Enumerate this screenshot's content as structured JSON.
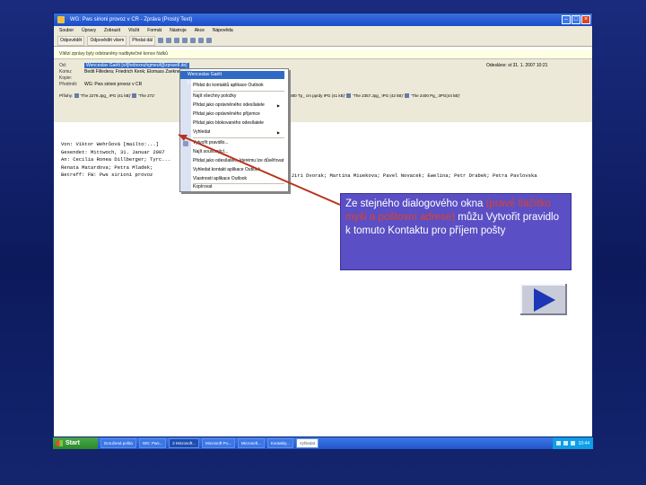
{
  "window": {
    "title": "WG: Pws sirioni provoz v CR - Zpráva (Prostý Text)",
    "menu": [
      "Soubor",
      "Úpravy",
      "Zobrazit",
      "Vložit",
      "Formát",
      "Nástroje",
      "Akce",
      "Nápověda"
    ],
    "toolbar": {
      "reply_label": "Odpovědět",
      "reply_all_label": "Odpovědět všem",
      "forward_label": "Předat dál"
    },
    "infobar": "Vítězi zprávy byly odstraněny nadbytečné konce řádků"
  },
  "header": {
    "from_label": "Od:",
    "from_value": "Wenceslav Gaëtt [vít]hebvxnuhgmeuf@zpravdl.de]",
    "to_label": "Komu:",
    "to_value": "Bedit Filledera; Friedrich Kenk; Elomass Zsekner",
    "cc_label": "Kopie:",
    "subject_label": "Předmět:",
    "subject_value": "WG: Pws sirioni provoz v CR",
    "sent_label": "Odesláno:",
    "sent_value": "st 31. 1. 2007 10:21",
    "attach_label": "Přílohy:",
    "attachments": [
      "'The  2279.Jpg_ IPG (41 kB)'",
      "'The 272'",
      "'The 1280 Tp_ cm pprdy IPG (41 kB)'",
      "'The 2357.Jpg_ IPG (42 kB)'",
      "'The 2400 Pg_ 3PG(44 kB)'"
    ]
  },
  "body_lines": [
    "Von: Viktor Wehrůová [mailto:...]",
    "Gesendet: Mittwoch, 31. Januar 2007",
    "An: Cecilia Ronea Dillberger; Tyrc...",
    "Renata Matardova; Petra Mladek;",
    "Betreff: FW: Pws sirioni provoz"
  ],
  "body_extra": "; Jiri Dvorak; Martina Miuekova; Pavel Novacek; Ewelina; Petr Drabek; Petra Pavlovska",
  "context_menu": {
    "items": [
      "Přidat do kontaktů aplikace Outlook",
      "Najít všechny položky",
      "Přidat jako oprávněného odesílatele",
      "Přidat jako oprávněného příjemce",
      "Přidat jako blokovaného odesílatele",
      "Vyhledat",
      "Vytvořit pravidlo...",
      "Najít související...",
      "Přidat jako odesílatele, kterému lze důvěřovat",
      "Vyhledat kontakt aplikace Outlook",
      "Vlastnosti aplikace Outlook",
      "Kopírovat"
    ],
    "highlighted": "Wenceslav Gaëtt [vít]hebvxnuhgmeuf@zpravdl.de]"
  },
  "taskbar": {
    "start_label": "Start",
    "tasks": [
      "Doručená pošta",
      "WG: Pws...",
      "2 Microsoft...",
      "Microsoft Po...",
      "Microsoft...",
      "Kontakty..."
    ],
    "search_placeholder": "Vyhledat",
    "clock": "10:44"
  },
  "callout": {
    "text_before": "Ze stejného dialogového okna ",
    "text_red": "(pravé tlačítko myši a poštovní adrese)",
    "text_after": " můžu Vytvořit pravidlo k tomuto Kontaktu pro příjem pošty"
  },
  "colors": {
    "slide_background": "#0f1e66",
    "callout_fill": "#5a4fc4",
    "callout_red": "#e0412a",
    "arrow_red": "#b8321c",
    "play_triangle": "#1e36b8"
  },
  "icons": [
    "window-icon",
    "minimize-icon",
    "maximize-icon",
    "close-icon",
    "start-flag-icon",
    "play-icon"
  ]
}
